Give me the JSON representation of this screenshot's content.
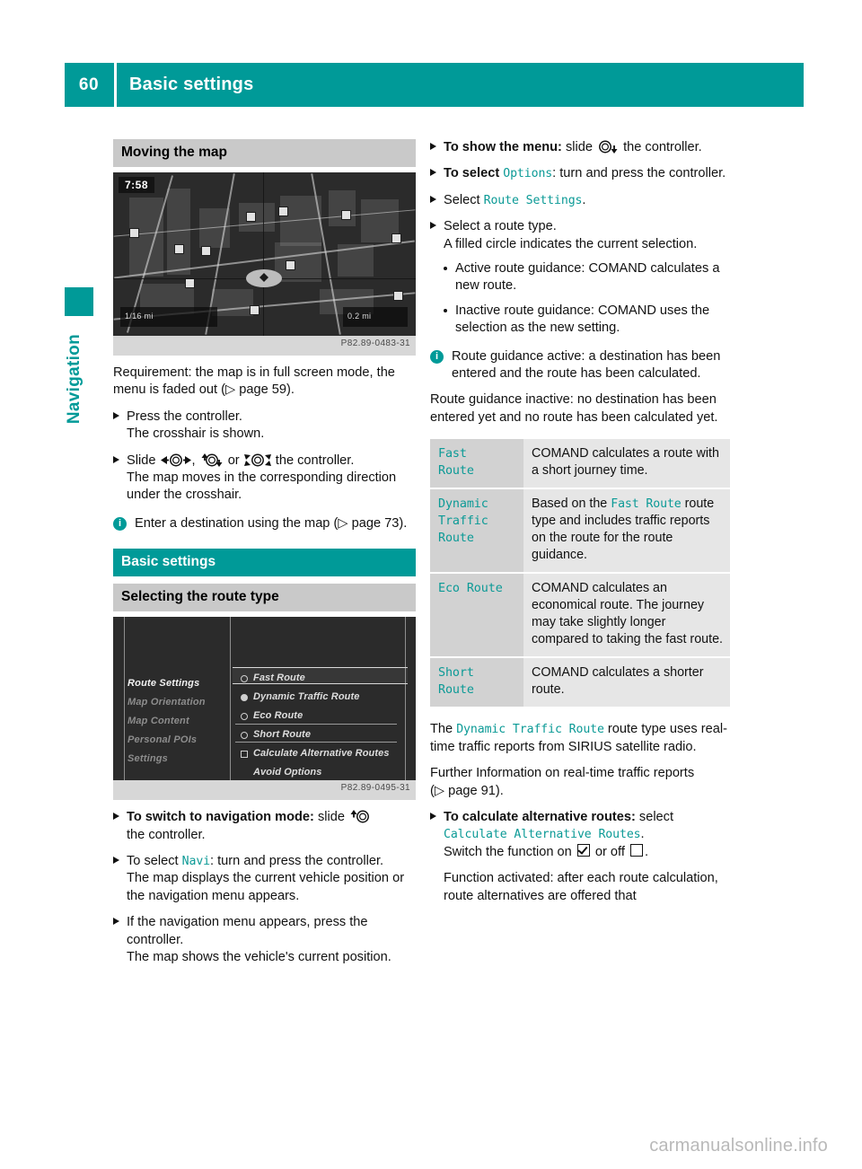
{
  "header": {
    "page_number": "60",
    "title": "Basic settings"
  },
  "side_tab": {
    "label": "Navigation"
  },
  "left_column": {
    "section_heading": "Moving the map",
    "figure_map": {
      "caption": "P82.89-0483-31",
      "clock": "7:58",
      "scale_left": "1/16 mi",
      "scale_right": "0.2 mi"
    },
    "requirement": "Requirement: the map is in full screen mode, the menu is faded out (",
    "requirement_ref": "page 59",
    "requirement_tail": ").",
    "step_press": "Press the controller.",
    "step_press_sub": "The crosshair is shown.",
    "step_slide_pre": "Slide",
    "step_slide_mid": ", ",
    "step_slide_or": "or",
    "step_slide_post": "the controller.",
    "step_slide_sub": "The map moves in the corresponding direction under the crosshair.",
    "note_map_pre": "Enter a destination using the map (",
    "note_map_ref": "page 73",
    "note_map_tail": ").",
    "basic_settings_heading": "Basic settings",
    "route_type_heading": "Selecting the route type",
    "figure_menu": {
      "caption": "P82.89-0495-31",
      "left_items": [
        "Route Settings",
        "Map Orientation",
        "Map Content",
        "Personal POIs",
        "Settings"
      ],
      "left_active_index": 0,
      "right_items": [
        {
          "label": "Fast Route",
          "marker": "radio",
          "filled": false,
          "highlighted": true
        },
        {
          "label": "Dynamic Traffic Route",
          "marker": "radio",
          "filled": true,
          "highlighted": false
        },
        {
          "label": "Eco Route",
          "marker": "radio",
          "filled": false,
          "highlighted": false
        },
        {
          "label": "Short Route",
          "marker": "radio",
          "filled": false,
          "highlighted": false
        },
        {
          "label": "Calculate Alternative Routes",
          "marker": "checkbox",
          "filled": false,
          "highlighted": false
        },
        {
          "label": "Avoid Options",
          "marker": "none",
          "filled": false,
          "highlighted": false
        }
      ]
    },
    "step_nav_mode_bold": "To switch to navigation mode:",
    "step_nav_mode_rest": "slide",
    "step_nav_mode_tail": "the controller.",
    "step_select_navi_pre": "To select",
    "step_select_navi_code": "Navi",
    "step_select_navi_post": ": turn and press the controller.",
    "step_select_navi_sub": "The map displays the current vehicle position or the navigation menu appears.",
    "step_menu_appears": "If the navigation menu appears, press the controller.",
    "step_menu_appears_sub": "The map shows the vehicle's current position."
  },
  "right_column": {
    "step_show_menu_bold": "To show the menu:",
    "step_show_menu_rest": "slide",
    "step_show_menu_tail": "the controller.",
    "step_select_options_bold": "To select",
    "step_select_options_code": "Options",
    "step_select_options_rest": ": turn and press the controller.",
    "step_select_route_settings_pre": "Select",
    "step_select_route_settings_code": "Route Settings",
    "step_select_route_settings_post": ".",
    "step_select_route_type": "Select a route type.",
    "step_select_route_type_sub": "A filled circle indicates the current selection.",
    "bullets": [
      "Active route guidance: COMAND calculates a new route.",
      "Inactive route guidance: COMAND uses the selection as the new setting."
    ],
    "note_guidance_1": "Route guidance active: a destination has been entered and the route has been calculated.",
    "note_guidance_2": "Route guidance inactive: no destination has been entered yet and no route has been calculated yet.",
    "table": {
      "rows": [
        {
          "name": "Fast\nRoute",
          "desc_pre": "COMAND calculates a route with a short journey time.",
          "desc_code": "",
          "desc_post": ""
        },
        {
          "name": "Dynamic\nTraffic\nRoute",
          "desc_pre": "Based on the ",
          "desc_code": "Fast Route",
          "desc_post": " route type and includes traffic reports on the route for the route guidance."
        },
        {
          "name": "Eco Route",
          "desc_pre": "COMAND calculates an economical route. The journey may take slightly longer compared to taking the fast route.",
          "desc_code": "",
          "desc_post": ""
        },
        {
          "name": "Short\nRoute",
          "desc_pre": "COMAND calculates a shorter route.",
          "desc_code": "",
          "desc_post": ""
        }
      ]
    },
    "para_dtr_pre": "The",
    "para_dtr_code": "Dynamic Traffic Route",
    "para_dtr_post": "route type uses real-time traffic reports from SIRIUS satellite radio.",
    "para_further_pre": "Further Information on real-time traffic reports (",
    "para_further_ref": "page 91",
    "para_further_tail": ").",
    "step_alt_bold": "To calculate alternative routes:",
    "step_alt_rest": "select",
    "step_alt_code": "Calculate Alternative Routes",
    "step_alt_period": ".",
    "step_alt_switch_pre": "Switch the function on",
    "step_alt_switch_mid": "or off",
    "step_alt_switch_post": ".",
    "step_alt_tail": "Function activated: after each route calculation, route alternatives are offered that"
  },
  "footer": {
    "watermark": "carmanualsonline.info"
  },
  "colors": {
    "teal": "#009a98",
    "heading_gray": "#c9c9c9",
    "table_col1": "#d2d2d2",
    "table_col2": "#e6e6e6"
  }
}
